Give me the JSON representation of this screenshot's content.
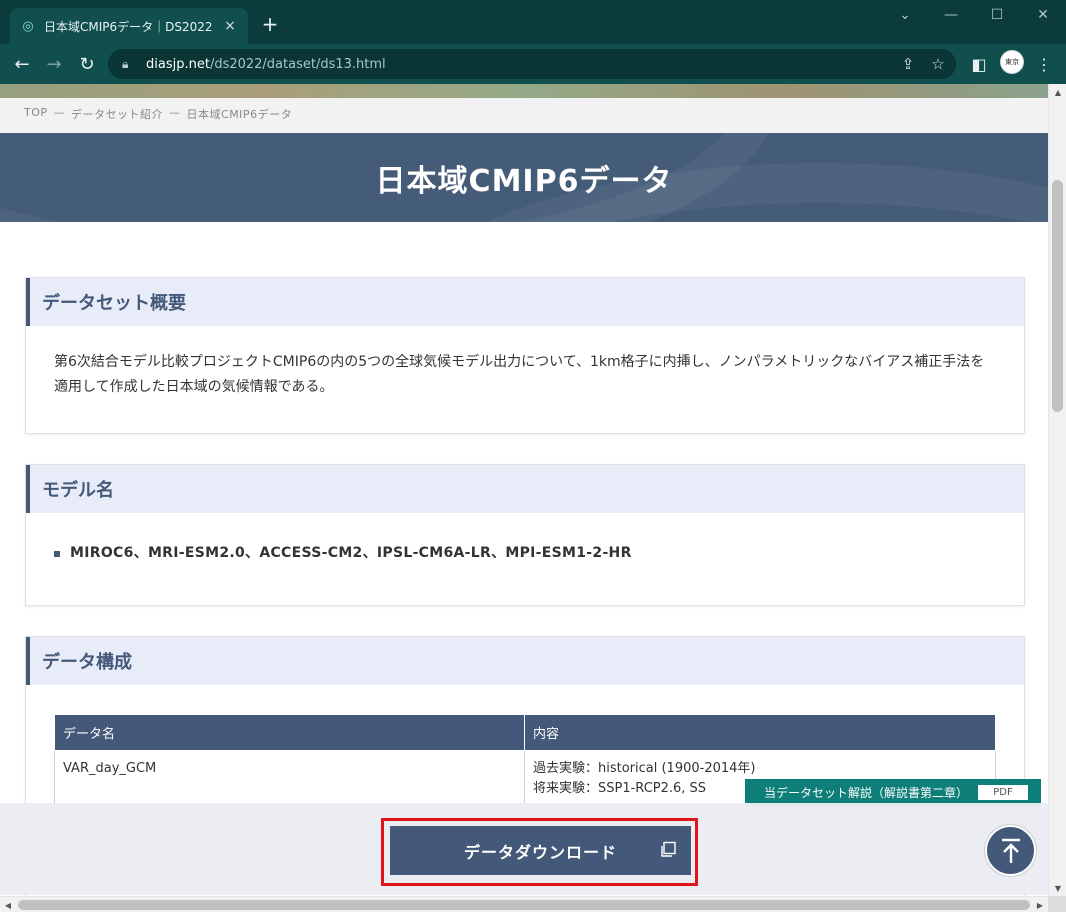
{
  "browser": {
    "tab_title": "日本域CMIP6データ｜DS2022 デ…",
    "tab_close": "×",
    "new_tab": "+",
    "url_host": "diasjp.net",
    "url_path": "/ds2022/dataset/ds13.html",
    "avatar_text": "東京"
  },
  "breadcrumb": {
    "items": [
      "TOP",
      "データセット紹介",
      "日本域CMIP6データ"
    ],
    "separator": "—"
  },
  "page": {
    "title": "日本域CMIP6データ"
  },
  "sections": {
    "overview": {
      "heading": "データセット概要",
      "body": "第6次結合モデル比較プロジェクトCMIP6の内の5つの全球気候モデル出力について、1km格子に内挿し、ノンパラメトリックなバイアス補正手法を適用して作成した日本域の気候情報である。"
    },
    "models": {
      "heading": "モデル名",
      "items": [
        "MIROC6、MRI-ESM2.0、ACCESS-CM2、IPSL-CM6A-LR、MPI-ESM1-2-HR"
      ]
    },
    "structure": {
      "heading": "データ構成",
      "columns": [
        "データ名",
        "内容"
      ],
      "rows": [
        {
          "name": "VAR_day_GCM",
          "content_lines": [
            "過去実験：historical (1900-2014年)",
            "将来実験：SSP1-RCP2.6, SS"
          ]
        }
      ]
    }
  },
  "floating": {
    "pdf_label": "当データセット解説（解説書第二章）",
    "pdf_tag": "PDF",
    "download_label": "データダウンロード"
  },
  "colors": {
    "brand": "#44597a",
    "teal": "#0d7e78",
    "highlight": "#e1141b"
  }
}
